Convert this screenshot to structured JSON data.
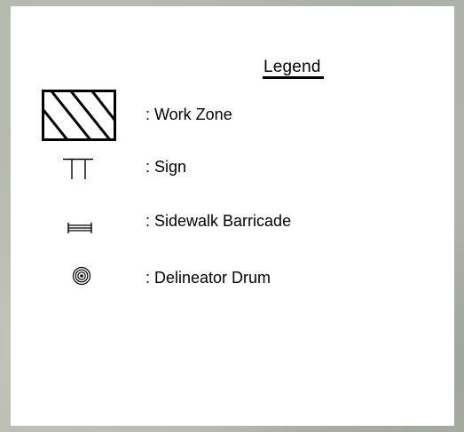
{
  "legend": {
    "title": "Legend",
    "items": [
      {
        "icon": "work-zone-hatch-icon",
        "label": ": Work Zone"
      },
      {
        "icon": "sign-icon",
        "label": ": Sign"
      },
      {
        "icon": "sidewalk-barricade-icon",
        "label": ": Sidewalk Barricade"
      },
      {
        "icon": "delineator-drum-icon",
        "label": ": Delineator Drum"
      }
    ]
  },
  "colors": {
    "panel": "#ffffff",
    "symbol": "#000000",
    "map_background": "#b4b7ad"
  }
}
